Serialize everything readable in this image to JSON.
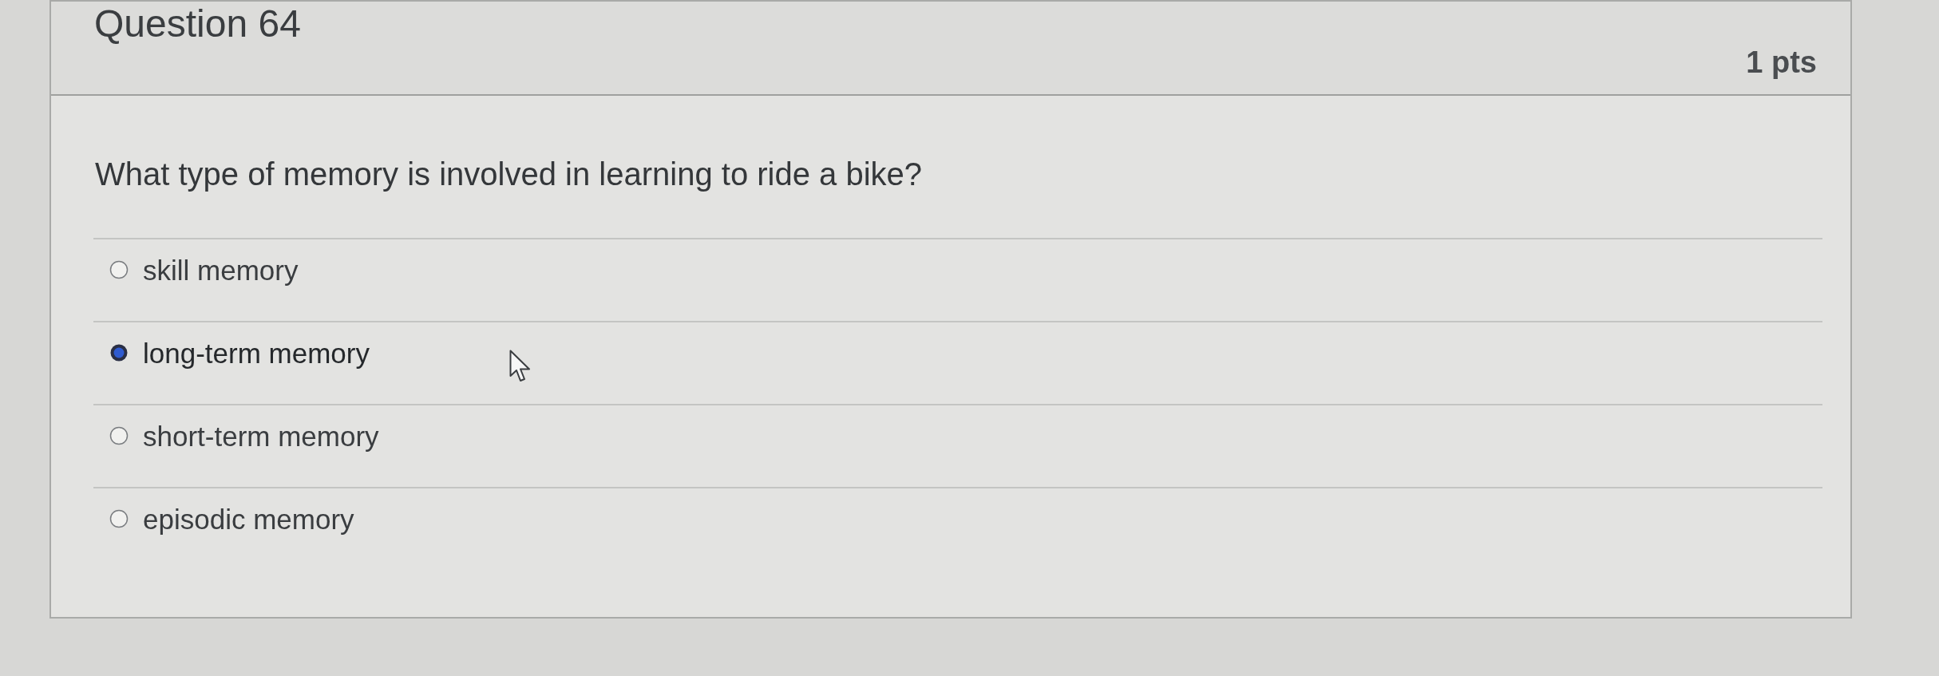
{
  "question": {
    "title": "Question 64",
    "points": "1 pts",
    "text": "What type of memory is involved in learning to ride a bike?",
    "answers": [
      {
        "label": "skill memory",
        "selected": false
      },
      {
        "label": "long-term memory",
        "selected": true
      },
      {
        "label": "short-term memory",
        "selected": false
      },
      {
        "label": "episodic memory",
        "selected": false
      }
    ]
  },
  "pointer": {
    "visible": true
  }
}
